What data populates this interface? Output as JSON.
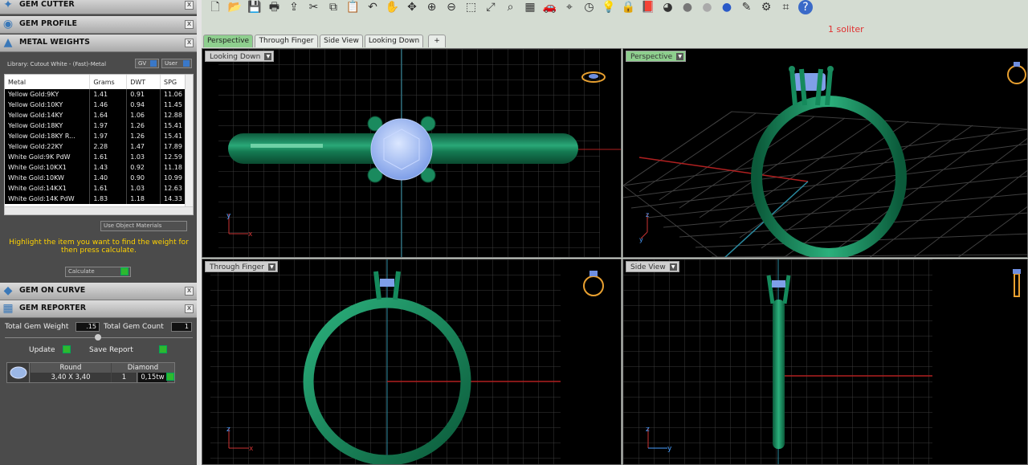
{
  "left_panel": {
    "sections": {
      "gem_cutter": "GEM CUTTER",
      "gem_profile": "GEM PROFILE",
      "metal_weights": "METAL WEIGHTS",
      "gem_on_curve": "GEM ON CURVE",
      "gem_reporter": "GEM REPORTER",
      "close_glyph": "x"
    },
    "library_label": "Library: Cutout White - (Fast)-Metal",
    "gv_label": "GV",
    "user_label": "User",
    "metal_table": {
      "headers": [
        "Metal",
        "Grams",
        "DWT",
        "SPG"
      ],
      "rows": [
        [
          "Yellow Gold:9KY",
          "1.41",
          "0.91",
          "11.06"
        ],
        [
          "Yellow Gold:10KY",
          "1.46",
          "0.94",
          "11.45"
        ],
        [
          "Yellow Gold:14KY",
          "1.64",
          "1.06",
          "12.88"
        ],
        [
          "Yellow Gold:18KY",
          "1.97",
          "1.26",
          "15.41"
        ],
        [
          "Yellow Gold:18KY R...",
          "1.97",
          "1.26",
          "15.41"
        ],
        [
          "Yellow Gold:22KY",
          "2.28",
          "1.47",
          "17.89"
        ],
        [
          "White Gold:9K PdW",
          "1.61",
          "1.03",
          "12.59"
        ],
        [
          "White Gold:10KX1",
          "1.43",
          "0.92",
          "11.18"
        ],
        [
          "White Gold:10KW",
          "1.40",
          "0.90",
          "10.99"
        ],
        [
          "White Gold:14KX1",
          "1.61",
          "1.03",
          "12.63"
        ],
        [
          "White Gold:14K PdW",
          "1.83",
          "1.18",
          "14.33"
        ]
      ]
    },
    "use_object_materials": "Use Object Materials",
    "instruction": "Highlight the item you want to find the weight for then press calculate.",
    "calculate_label": "Calculate",
    "total_gem_weight_label": "Total Gem Weight",
    "total_gem_weight_value": ".15",
    "total_gem_count_label": "Total Gem Count",
    "total_gem_count_value": "1",
    "update_label": "Update",
    "save_report_label": "Save Report",
    "gem_row": {
      "shape": "Round",
      "size": "3,40 X 3,40",
      "material": "Diamond",
      "count": "1",
      "weight": "0,15tw"
    }
  },
  "tabs": [
    "Perspective",
    "Through Finger",
    "Side View",
    "Looking Down",
    "+"
  ],
  "active_tab": "Perspective",
  "status_text": "1 soliter",
  "viewports": {
    "top_left": "Looking Down",
    "top_right": "Perspective",
    "bottom_left": "Through Finger",
    "bottom_right": "Side View"
  },
  "axis_labels": {
    "x": "x",
    "y": "y",
    "z": "z"
  },
  "toolbar_icons": [
    "new-icon",
    "open-icon",
    "save-icon",
    "print-icon",
    "import-icon",
    "cut-icon",
    "copy-icon",
    "paste-icon",
    "undo-icon",
    "pan-icon",
    "move-icon",
    "zoom-in-icon",
    "zoom-out-icon",
    "zoom-window-icon",
    "zoom-extents-icon",
    "zoom-selected-icon",
    "grid-icon",
    "car-icon",
    "snap-icon",
    "clock-icon",
    "light-icon",
    "lock-icon",
    "book-icon",
    "color-wheel-icon",
    "sphere-gray-icon",
    "sphere-silver-icon",
    "sphere-blue-icon",
    "wand-icon",
    "gear-icon",
    "crop-icon",
    "help-icon"
  ],
  "colors": {
    "metal": "#1a7a55",
    "gem": "#a9c4ff",
    "grid": "#3a3a3a",
    "accent_tab": "#8ecf8e",
    "status_red": "#e03030",
    "highlight_yellow": "#ffd200"
  }
}
